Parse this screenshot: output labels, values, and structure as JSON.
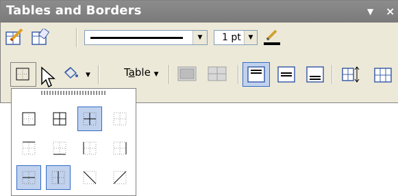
{
  "window": {
    "title": "Tables and Borders"
  },
  "toolbar": {
    "line_weight": "1 pt",
    "table_menu_label_pre": "T",
    "table_menu_label_u": "a",
    "table_menu_label_post": "ble"
  },
  "colors": {
    "selection_bg": "#c1d2ee",
    "selection_border": "#316ac5",
    "titlebar": "#808080"
  }
}
